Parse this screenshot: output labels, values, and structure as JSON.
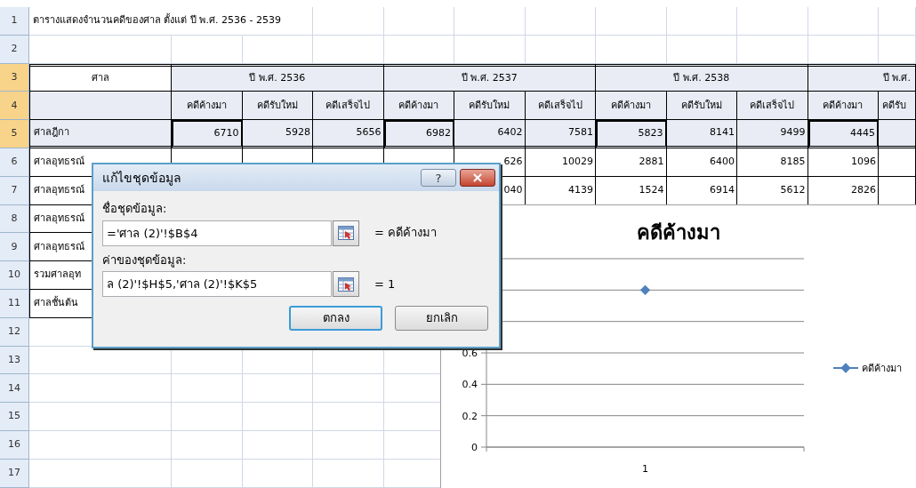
{
  "sheet": {
    "row_headers": [
      {
        "label": "1",
        "selected": false
      },
      {
        "label": "2",
        "selected": false
      },
      {
        "label": "3",
        "selected": true
      },
      {
        "label": "4",
        "selected": true
      },
      {
        "label": "5",
        "selected": true
      },
      {
        "label": "6",
        "selected": false
      },
      {
        "label": "7",
        "selected": false
      },
      {
        "label": "8",
        "selected": false
      },
      {
        "label": "9",
        "selected": false
      },
      {
        "label": "10",
        "selected": false
      },
      {
        "label": "11",
        "selected": false
      },
      {
        "label": "12",
        "selected": false
      },
      {
        "label": "13",
        "selected": false
      },
      {
        "label": "14",
        "selected": false
      },
      {
        "label": "15",
        "selected": false
      },
      {
        "label": "16",
        "selected": false
      },
      {
        "label": "17",
        "selected": false
      }
    ],
    "title": "ตารางแสดงจำนวนคดีของศาล ตั้งแต่ ปี พ.ศ. 2536 - 2539",
    "table": {
      "corner": "ศาล",
      "years": [
        "ปี พ.ศ. 2536",
        "ปี พ.ศ. 2537",
        "ปี พ.ศ. 2538",
        "ปี พ.ศ."
      ],
      "subheaders": [
        "คดีค้างมา",
        "คดีรับใหม่",
        "คดีเสร็จไป",
        "คดีค้างมา",
        "คดีรับใหม่",
        "คดีเสร็จไป",
        "คดีค้างมา",
        "คดีรับใหม่",
        "คดีเสร็จไป",
        "คดีค้างมา",
        "คดีรับ"
      ],
      "rows": [
        {
          "label": "ศาลฎีกา",
          "values": [
            {
              "text": "6710",
              "marked": true
            },
            {
              "text": "5928",
              "marked": false
            },
            {
              "text": "5656",
              "marked": false
            },
            {
              "text": "6982",
              "marked": true
            },
            {
              "text": "6402",
              "marked": false
            },
            {
              "text": "7581",
              "marked": false
            },
            {
              "text": "5823",
              "marked": true
            },
            {
              "text": "8141",
              "marked": false
            },
            {
              "text": "9499",
              "marked": false
            },
            {
              "text": "4445",
              "marked": true
            }
          ]
        },
        {
          "label": "ศาลอุทธรณ์",
          "values": [
            {
              "text": "626",
              "marked": false
            },
            {
              "text": "10029",
              "marked": false
            },
            {
              "text": "2881",
              "marked": false
            },
            {
              "text": "6400",
              "marked": false
            },
            {
              "text": "8185",
              "marked": false
            },
            {
              "text": "1096",
              "marked": false
            }
          ]
        },
        {
          "label": "ศาลอุทธรณ์",
          "values": [
            {
              "text": "040",
              "marked": false
            },
            {
              "text": "4139",
              "marked": false
            },
            {
              "text": "1524",
              "marked": false
            },
            {
              "text": "6914",
              "marked": false
            },
            {
              "text": "5612",
              "marked": false
            },
            {
              "text": "2826",
              "marked": false
            }
          ]
        },
        {
          "label": "ศาลอุทธรณ์",
          "values": []
        },
        {
          "label": "ศาลอุทธรณ์",
          "values": []
        },
        {
          "label": "รวมศาลอุท",
          "values": []
        },
        {
          "label": "ศาลชั้นต้น",
          "values": []
        }
      ]
    }
  },
  "dialog": {
    "title": "แก้ไขชุดข้อมูล",
    "help": "?",
    "fields": [
      {
        "label": "ชื่อชุดข้อมูล:",
        "value": "='ศาล (2)'!$B$4",
        "result": "= คดีค้างมา"
      },
      {
        "label": "ค่าของชุดข้อมูล:",
        "value": "ล (2)'!$H$5,'ศาล (2)'!$K$5",
        "result": "= 1"
      }
    ],
    "buttons": [
      {
        "label": "ตกลง",
        "default": true
      },
      {
        "label": "ยกเลิก",
        "default": false
      }
    ]
  },
  "chart": {
    "chart_data": {
      "type": "line",
      "title": "คดีค้างมา",
      "categories": [
        "1"
      ],
      "series": [
        {
          "name": "คดีค้างมา",
          "color": "#4f81bd",
          "marker": "diamond",
          "values": [
            1
          ]
        }
      ],
      "grid": true,
      "ylim": [
        0,
        1.2
      ],
      "yticks": [
        0,
        0.2,
        0.4,
        0.6
      ]
    }
  }
}
